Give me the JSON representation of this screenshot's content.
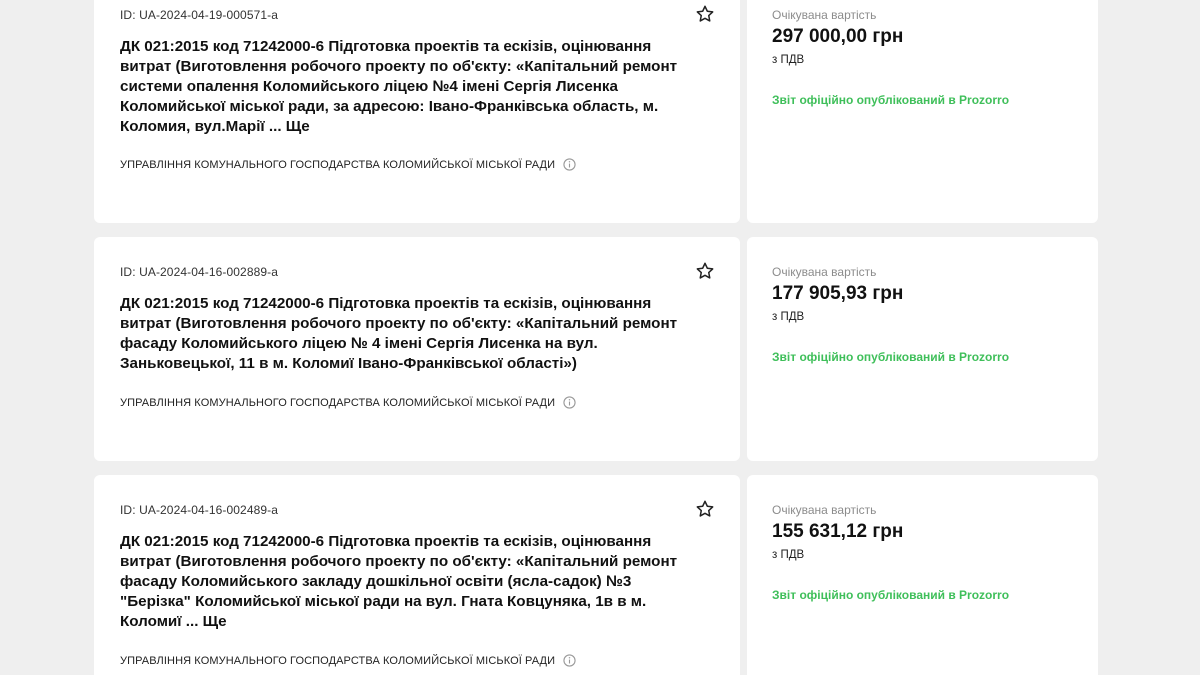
{
  "tenders": [
    {
      "id": "ID: UA-2024-04-19-000571-a",
      "title": "ДК 021:2015 код 71242000-6 Підготовка проектів та ескізів, оцінювання витрат (Виготовлення робочого проекту по об'єкту: «Капітальний ремонт системи опалення Коломийського ліцею №4 імені Сергія Лисенка Коломийської міської ради, за адресою: Івано-Франківська область, м. Коломия, вул.Марії ... Ще",
      "organization": "УПРАВЛІННЯ КОМУНАЛЬНОГО ГОСПОДАРСТВА КОЛОМИЙСЬКОЇ МІСЬКОЇ РАДИ",
      "price_label": "Очікувана вартість",
      "price": "297 000,00 грн",
      "vat": "з ПДВ",
      "status": "Звіт офіційно опублікований в Prozorro"
    },
    {
      "id": "ID: UA-2024-04-16-002889-a",
      "title": "ДК 021:2015 код 71242000-6 Підготовка проектів та ескізів, оцінювання витрат (Виготовлення робочого проекту по об'єкту: «Капітальний ремонт фасаду Коломийського ліцею № 4 імені Сергія Лисенка на вул. Заньковецької, 11 в м. Коломиї Івано-Франківської області»)",
      "organization": "УПРАВЛІННЯ КОМУНАЛЬНОГО ГОСПОДАРСТВА КОЛОМИЙСЬКОЇ МІСЬКОЇ РАДИ",
      "price_label": "Очікувана вартість",
      "price": "177 905,93 грн",
      "vat": "з ПДВ",
      "status": "Звіт офіційно опублікований в Prozorro"
    },
    {
      "id": "ID: UA-2024-04-16-002489-a",
      "title": "ДК 021:2015 код 71242000-6 Підготовка проектів та ескізів, оцінювання витрат (Виготовлення робочого проекту по об'єкту: «Капітальний ремонт фасаду Коломийського закладу дошкільної освіти (ясла-садок) №3 \"Берізка\" Коломийської міської ради на вул. Гната Ковцуняка, 1в в м. Коломиї ... Ще",
      "organization": "УПРАВЛІННЯ КОМУНАЛЬНОГО ГОСПОДАРСТВА КОЛОМИЙСЬКОЇ МІСЬКОЇ РАДИ",
      "price_label": "Очікувана вартість",
      "price": "155 631,12 грн",
      "vat": "з ПДВ",
      "status": "Звіт офіційно опублікований в Prozorro"
    }
  ],
  "icons": {
    "favorite": "star-outline-icon",
    "info": "info-circle-icon"
  },
  "colors": {
    "status_green": "#3fbf5a",
    "card_bg": "#ffffff",
    "page_bg": "#efefef",
    "muted": "#8c8c8c"
  }
}
